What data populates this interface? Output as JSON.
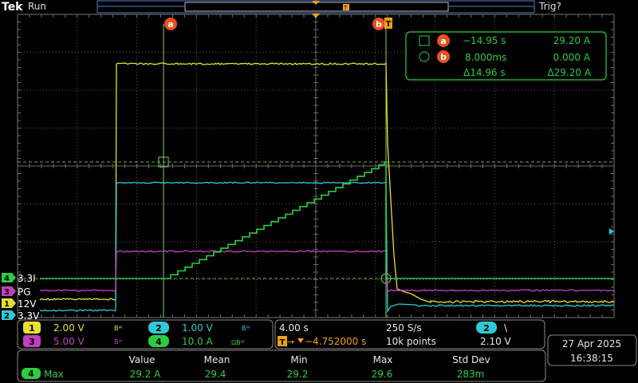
{
  "header": {
    "brand": "Tek",
    "run_status": "Run",
    "trigger_status": "Trig?"
  },
  "cursors": {
    "a_label": "a",
    "b_label": "b",
    "a_time": "−14.95 s",
    "a_value": "29.20 A",
    "b_time": "8.000ms",
    "b_value": "0.000 A",
    "delta_time": "Δ14.96 s",
    "delta_value": "Δ29.20 A"
  },
  "channel_markers": [
    {
      "number": "4",
      "label": "3.3I",
      "color": "#2ecc40"
    },
    {
      "number": "3",
      "label": "PG",
      "color": "#c040c0"
    },
    {
      "number": "1",
      "label": "12V",
      "color": "#e8e030"
    },
    {
      "number": "2",
      "label": "3.3V",
      "color": "#30c8d8"
    }
  ],
  "channel_settings": [
    {
      "number": "1",
      "scale": "2.00 V",
      "bw": "Bᵂ",
      "color": "#e8e030",
      "text_color": "#e8e030"
    },
    {
      "number": "2",
      "scale": "1.00 V",
      "bw": "Bᵂ",
      "color": "#30c8d8",
      "text_color": "#30c8d8"
    },
    {
      "number": "3",
      "scale": "5.00 V",
      "bw": "Bᵂ",
      "color": "#c040c0",
      "text_color": "#c040c0"
    },
    {
      "number": "4",
      "scale": "10.0 A",
      "bw": "ΩBᵂ",
      "color": "#2ecc40",
      "text_color": "#2ecc40"
    }
  ],
  "timebase": {
    "horizontal_scale": "4.00 s",
    "sample_rate": "250 S/s",
    "trigger_position": "−4.752000 s",
    "record_length": "10k points"
  },
  "trigger": {
    "source": "2",
    "slope": "\\",
    "level": "2.10 V"
  },
  "datetime": {
    "date": "27 Apr  2025",
    "time": "16:38:15"
  },
  "measurement": {
    "headers": [
      "Value",
      "Mean",
      "Min",
      "Max",
      "Std Dev"
    ],
    "channel": "4",
    "name": "Max",
    "values": [
      "29.2 A",
      "29.4",
      "29.2",
      "29.6",
      "283m"
    ]
  },
  "colors": {
    "ch1": "#e8e030",
    "ch2": "#30c8d8",
    "ch3": "#c040c0",
    "ch4": "#2ecc40",
    "cursor": "#e8501a",
    "trigger_marker": "#f0a010",
    "grid": "#6a6a6a"
  }
}
